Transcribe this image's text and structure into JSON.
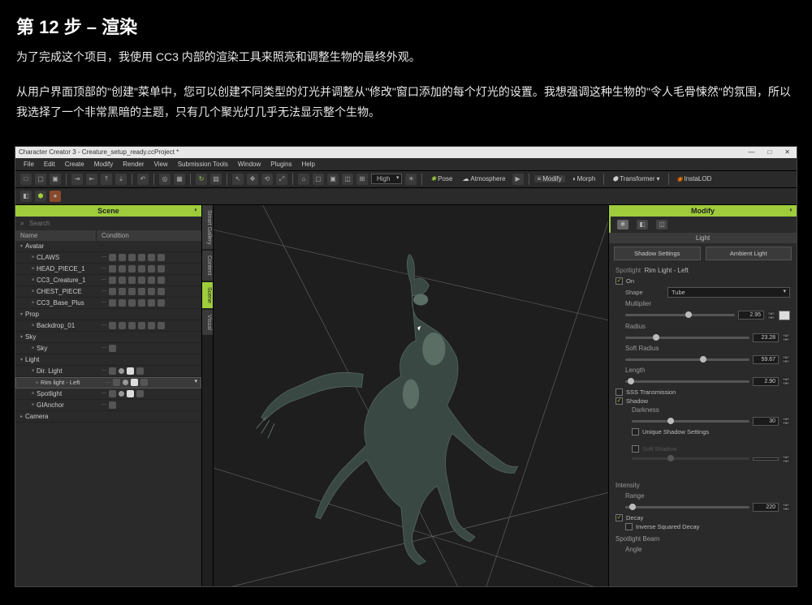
{
  "article": {
    "heading": "第 12 步 – 渲染",
    "p1": "为了完成这个项目，我使用 CC3 内部的渲染工具来照亮和调整生物的最终外观。",
    "p2": "从用户界面顶部的\"创建\"菜单中，您可以创建不同类型的灯光并调整从\"修改\"窗口添加的每个灯光的设置。我想强调这种生物的\"令人毛骨悚然\"的氛围，所以我选择了一个非常黑暗的主题，只有几个聚光灯几乎无法显示整个生物。"
  },
  "app": {
    "title": "Character Creator 3 - Creature_setup_ready.ccProject *",
    "win_min": "—",
    "win_max": "□",
    "win_close": "✕",
    "menus": [
      "File",
      "Edit",
      "Create",
      "Modify",
      "Render",
      "View",
      "Submission Tools",
      "Window",
      "Plugins",
      "Help"
    ],
    "toolbar": {
      "quality": "High",
      "pose": "Pose",
      "atmos": "Atmosphere",
      "modify": "Modify",
      "morph": "Morph",
      "transformer": "Transformer",
      "instalod": "InstaLOD"
    },
    "scene": {
      "title": "Scene",
      "search_placeholder": "Search",
      "col_name": "Name",
      "col_cond": "Condition",
      "rows": [
        {
          "label": "Avatar",
          "depth": 0,
          "open": true,
          "cond": false
        },
        {
          "label": "CLAWS",
          "depth": 1,
          "cond": true
        },
        {
          "label": "HEAD_PIECE_1",
          "depth": 1,
          "cond": true
        },
        {
          "label": "CC3_Creature_1",
          "depth": 1,
          "cond": true
        },
        {
          "label": "CHEST_PIECE",
          "depth": 1,
          "cond": true
        },
        {
          "label": "CC3_Base_Plus",
          "depth": 1,
          "cond": true
        },
        {
          "label": "Prop",
          "depth": 0,
          "open": true,
          "cond": false
        },
        {
          "label": "Backdrop_01",
          "depth": 1,
          "cond": true
        },
        {
          "label": "Sky",
          "depth": 0,
          "open": true,
          "cond": false
        },
        {
          "label": "Sky",
          "depth": 1,
          "cond": true,
          "single": true
        },
        {
          "label": "Light",
          "depth": 0,
          "open": true,
          "cond": false
        },
        {
          "label": "Dir. Light",
          "depth": 1,
          "cond": true,
          "lite": true
        },
        {
          "label": "Rim light - Left",
          "depth": 1,
          "cond": true,
          "sel": true,
          "lite": true
        },
        {
          "label": "Spotlight",
          "depth": 1,
          "cond": true,
          "lite": true
        },
        {
          "label": "GIAnchor",
          "depth": 1,
          "cond": true,
          "single": true
        },
        {
          "label": "Camera",
          "depth": 0,
          "open": false,
          "cond": false
        }
      ]
    },
    "sidetabs": [
      "Smart Gallery",
      "Content",
      "Scene",
      "Visual"
    ],
    "modify": {
      "title": "Modify",
      "section": "Light",
      "btn_shadow": "Shadow Settings",
      "btn_ambient": "Ambient Light",
      "spotlight_label": "Spotlight",
      "spotlight_name": "Rim Light - Left",
      "on": "On",
      "shape_label": "Shape",
      "shape_value": "Tube",
      "multiplier": "Multiplier",
      "multiplier_val": "2.95",
      "radius": "Radius",
      "radius_val": "23.28",
      "soft_radius": "Soft Radius",
      "soft_radius_val": "59.67",
      "length": "Length",
      "length_val": "2.90",
      "sss": "SSS Transmission",
      "shadow": "Shadow",
      "darkness": "Darkness",
      "darkness_val": "30",
      "unique": "Unique Shadow Settings",
      "soft_shadow": "Soft Shadow",
      "intensity": "Intensity",
      "range": "Range",
      "range_val": "220",
      "decay": "Decay",
      "inverse": "Inverse Squared Decay",
      "spotlight_beam": "Spotlight Beam",
      "angle": "Angle"
    }
  }
}
